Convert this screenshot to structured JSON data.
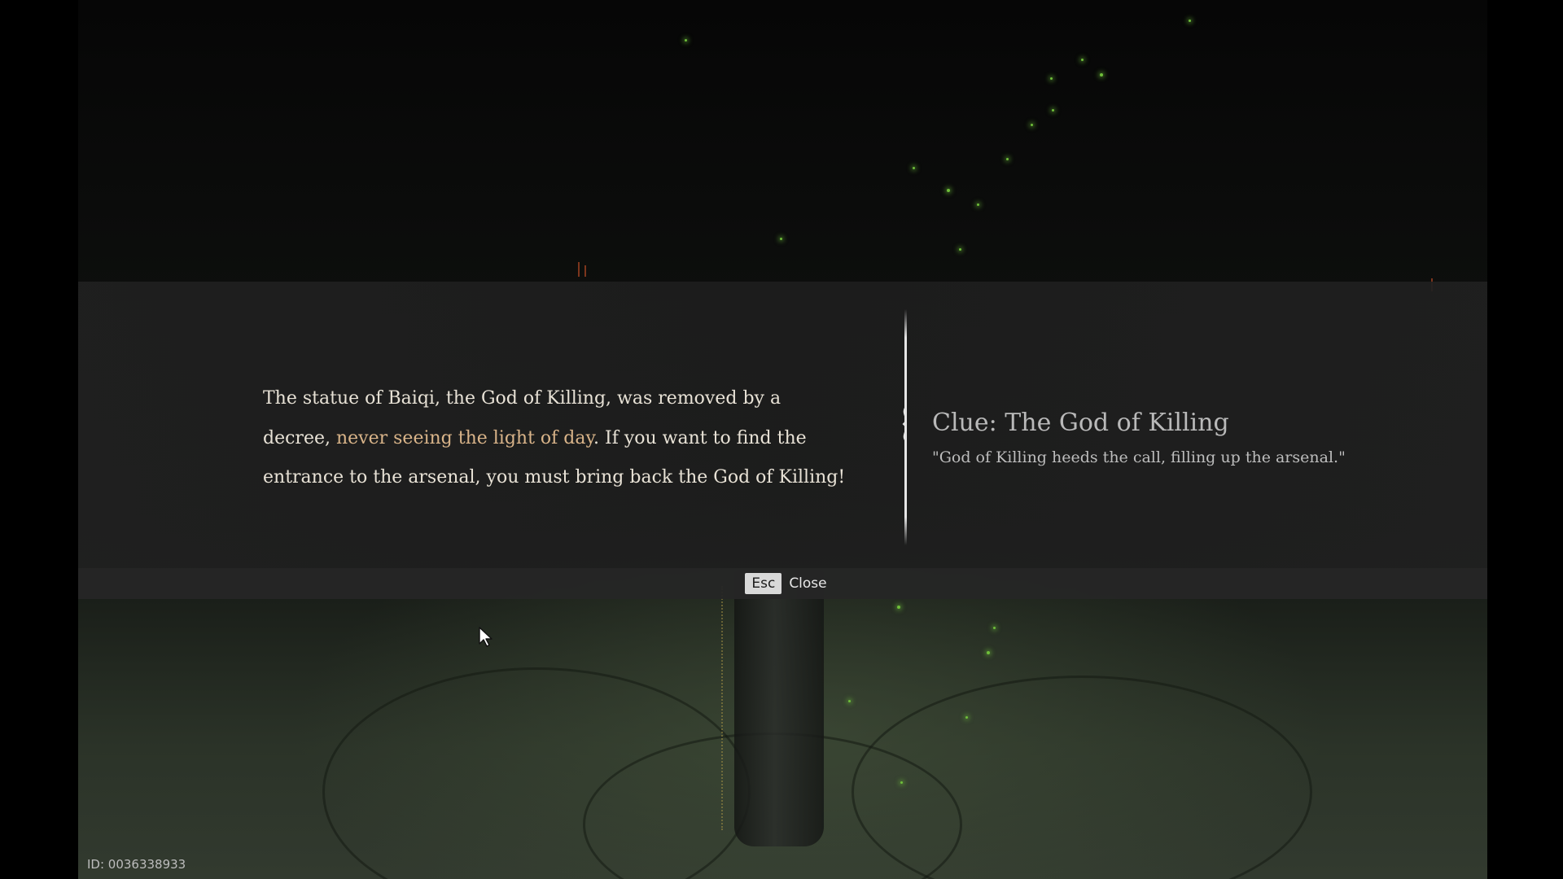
{
  "dialog": {
    "story_part1": "The statue of Baiqi, the God of Killing, was removed by a decree,",
    "story_highlight": "never seeing the light of day",
    "story_part2": ". If you want to find the entrance to the arsenal, you must bring back the God of Killing!",
    "highlight_color": "#d9b489"
  },
  "clue": {
    "title": "Clue: The God of Killing",
    "quote": "\"God of Killing heeds the call, filling up the arsenal.\""
  },
  "close_bar": {
    "key_label": "Esc",
    "action_label": "Close"
  },
  "footer": {
    "build_id": "ID: 0036338933"
  },
  "icons": {
    "cursor": "mouse-pointer-icon",
    "divider": "ornate-divider-icon"
  },
  "colors": {
    "sparkle_green": "#6fbf3a",
    "panel_bg": "#202020"
  }
}
